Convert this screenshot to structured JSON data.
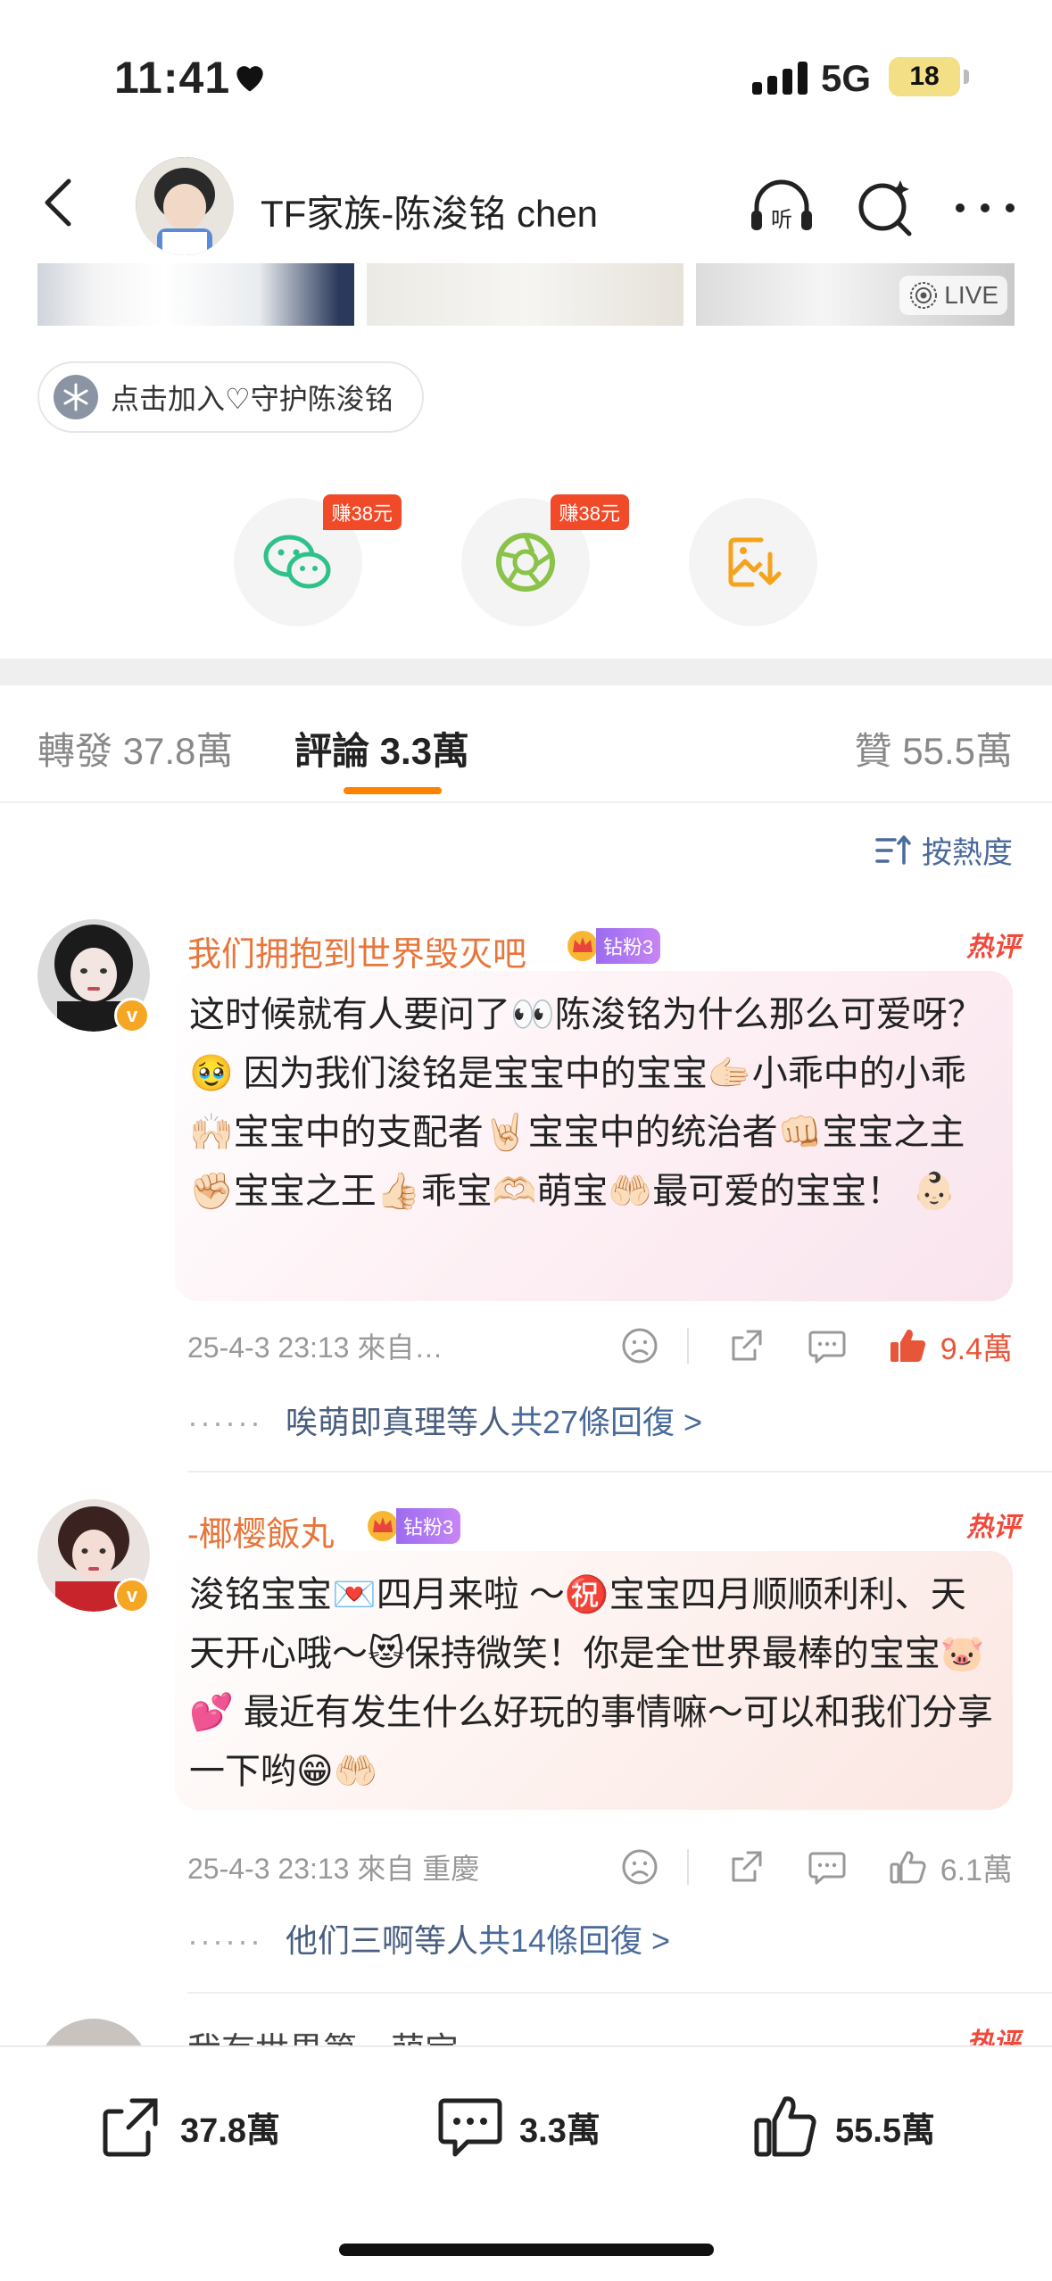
{
  "status": {
    "time": "11:41",
    "network": "5G",
    "battery": "18"
  },
  "header": {
    "title": "TF家族-陈浚铭 chen"
  },
  "photos": {
    "live_label": "LIVE"
  },
  "join": {
    "label": "点击加入♡守护陈浚铭"
  },
  "share": {
    "wechat_reward": "赚38元",
    "moments_reward": "赚38元"
  },
  "tabs": {
    "repost": "轉發 37.8萬",
    "comments": "評論 3.3萬",
    "likes": "贊 55.5萬"
  },
  "sort": {
    "label": "按熱度"
  },
  "comments": [
    {
      "user": "我们拥抱到世界毁灭吧",
      "fan_level": "钻粉3",
      "hot_label": "热评",
      "text": "这时候就有人要问了👀陈浚铭为什么那么可爱呀？ 🥹 因为我们浚铭是宝宝中的宝宝🫱🏻小乖中的小乖🙌🏻宝宝中的支配者🤘🏻宝宝中的统治者👊🏻宝宝之主✊🏻宝宝之王👍🏻乖宝🫶🏻萌宝🤲🏻最可爱的宝宝！ 👶🏻",
      "meta": "25-4-3 23:13  來自…",
      "likes": "9.4萬",
      "reply_users": "唉萌即真理等人",
      "reply_count": "共27條回復 >"
    },
    {
      "user": "-椰樱飯丸",
      "fan_level": "钻粉3",
      "hot_label": "热评",
      "text": "浚铭宝宝💌四月来啦 ～㊗️宝宝四月顺顺利利、天天开心哦～😻保持微笑！你是全世界最棒的宝宝🐷💕 最近有发生什么好玩的事情嘛～可以和我们分享一下哟😁🤲🏻",
      "meta": "25-4-3 23:13  來自 重慶",
      "likes": "6.1萬",
      "reply_users": "他们三啊等人",
      "reply_count": "共14條回復 >"
    },
    {
      "user": "我有世界第一萌宝",
      "hot_label": "热评"
    }
  ],
  "bottom": {
    "reposts": "37.8萬",
    "comments": "3.3萬",
    "likes": "55.5萬"
  },
  "colors": {
    "accent": "#ff8200",
    "name": "#e8753a",
    "link": "#4a6a9a",
    "hot": "#f04a3c"
  }
}
